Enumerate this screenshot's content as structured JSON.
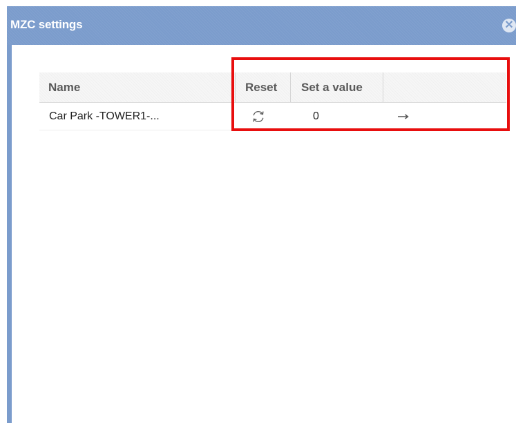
{
  "dialog": {
    "title": "MZC settings",
    "close_glyph": "✕"
  },
  "grid": {
    "columns": [
      "Name",
      "Reset",
      "Set a value",
      ""
    ],
    "rows": [
      {
        "name": "Car Park -TOWER1-...",
        "reset_icon": "refresh-icon",
        "value": "0",
        "apply_icon": "arrow-right-icon"
      }
    ]
  },
  "colors": {
    "titlebar": "#7b9ccc",
    "highlight": "#e80e0e"
  }
}
